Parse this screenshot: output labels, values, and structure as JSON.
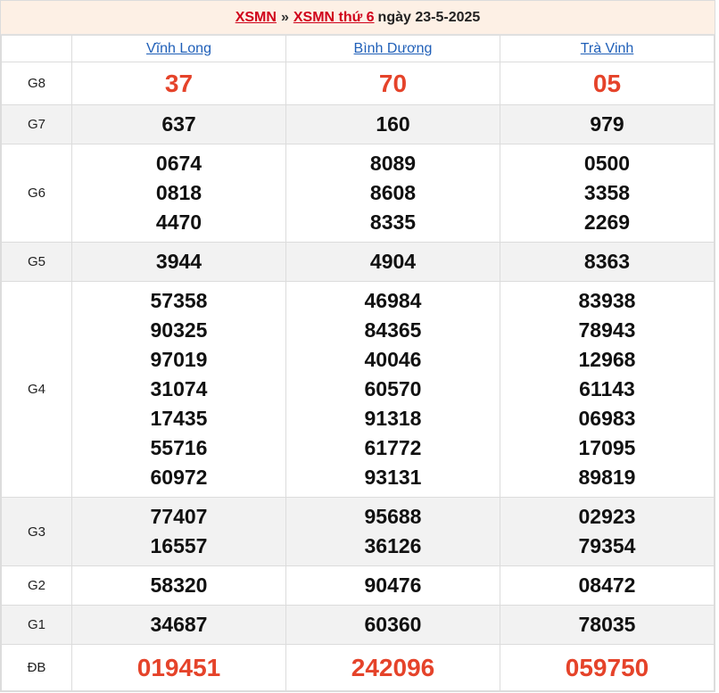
{
  "header": {
    "link1": "XSMN",
    "separator": "»",
    "link2": "XSMN thứ 6",
    "date_text": "ngày 23-5-2025"
  },
  "provinces": [
    "Vĩnh Long",
    "Bình Dương",
    "Trà Vinh"
  ],
  "prizes": [
    {
      "label": "G8",
      "style": "red",
      "values": [
        [
          "37"
        ],
        [
          "70"
        ],
        [
          "05"
        ]
      ]
    },
    {
      "label": "G7",
      "style": "normal",
      "values": [
        [
          "637"
        ],
        [
          "160"
        ],
        [
          "979"
        ]
      ]
    },
    {
      "label": "G6",
      "style": "normal",
      "values": [
        [
          "0674",
          "0818",
          "4470"
        ],
        [
          "8089",
          "8608",
          "8335"
        ],
        [
          "0500",
          "3358",
          "2269"
        ]
      ]
    },
    {
      "label": "G5",
      "style": "normal",
      "values": [
        [
          "3944"
        ],
        [
          "4904"
        ],
        [
          "8363"
        ]
      ]
    },
    {
      "label": "G4",
      "style": "normal",
      "values": [
        [
          "57358",
          "90325",
          "97019",
          "31074",
          "17435",
          "55716",
          "60972"
        ],
        [
          "46984",
          "84365",
          "40046",
          "60570",
          "91318",
          "61772",
          "93131"
        ],
        [
          "83938",
          "78943",
          "12968",
          "61143",
          "06983",
          "17095",
          "89819"
        ]
      ]
    },
    {
      "label": "G3",
      "style": "normal",
      "values": [
        [
          "77407",
          "16557"
        ],
        [
          "95688",
          "36126"
        ],
        [
          "02923",
          "79354"
        ]
      ]
    },
    {
      "label": "G2",
      "style": "normal",
      "values": [
        [
          "58320"
        ],
        [
          "90476"
        ],
        [
          "08472"
        ]
      ]
    },
    {
      "label": "G1",
      "style": "normal",
      "values": [
        [
          "34687"
        ],
        [
          "60360"
        ],
        [
          "78035"
        ]
      ]
    },
    {
      "label": "ĐB",
      "style": "red",
      "values": [
        [
          "019451"
        ],
        [
          "242096"
        ],
        [
          "059750"
        ]
      ]
    }
  ],
  "colors": {
    "accent_red": "#e5432a",
    "link_blue": "#1f5fb8",
    "header_bg": "#fdf0e5",
    "alt_row_bg": "#f2f2f2"
  }
}
